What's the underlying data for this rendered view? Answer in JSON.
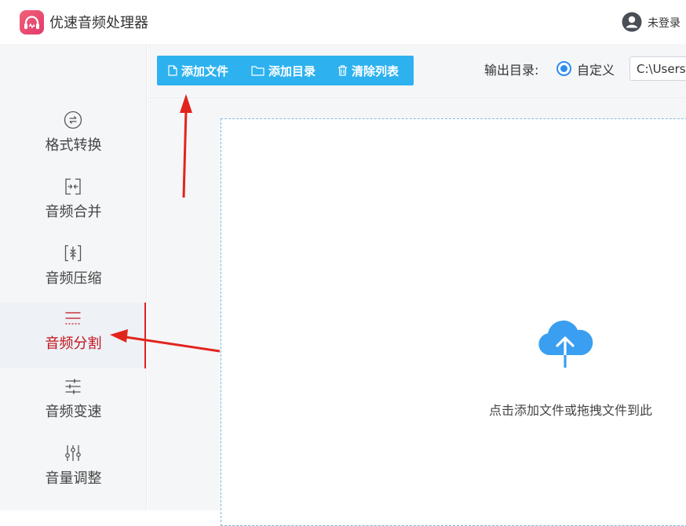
{
  "app": {
    "title": "优速音频处理器"
  },
  "user": {
    "label": "未登录"
  },
  "sidebar": {
    "items": [
      {
        "label": "格式转换",
        "icon": "format-convert-icon"
      },
      {
        "label": "音频合并",
        "icon": "merge-icon"
      },
      {
        "label": "音频压缩",
        "icon": "compress-icon"
      },
      {
        "label": "音频分割",
        "icon": "split-icon",
        "active": true
      },
      {
        "label": "音频变速",
        "icon": "sliders-icon"
      },
      {
        "label": "音量调整",
        "icon": "volume-adjust-icon"
      }
    ]
  },
  "toolbar": {
    "add_file": "添加文件",
    "add_folder": "添加目录",
    "clear_list": "清除列表"
  },
  "output": {
    "label": "输出目录:",
    "option": "自定义",
    "path": "C:\\Users"
  },
  "dropzone": {
    "text": "点击添加文件或拖拽文件到此"
  },
  "colors": {
    "accent": "#2db2ef",
    "active_text": "#c0141c",
    "annotation_arrow": "#e2241d",
    "cloud": "#3a9ff0"
  }
}
